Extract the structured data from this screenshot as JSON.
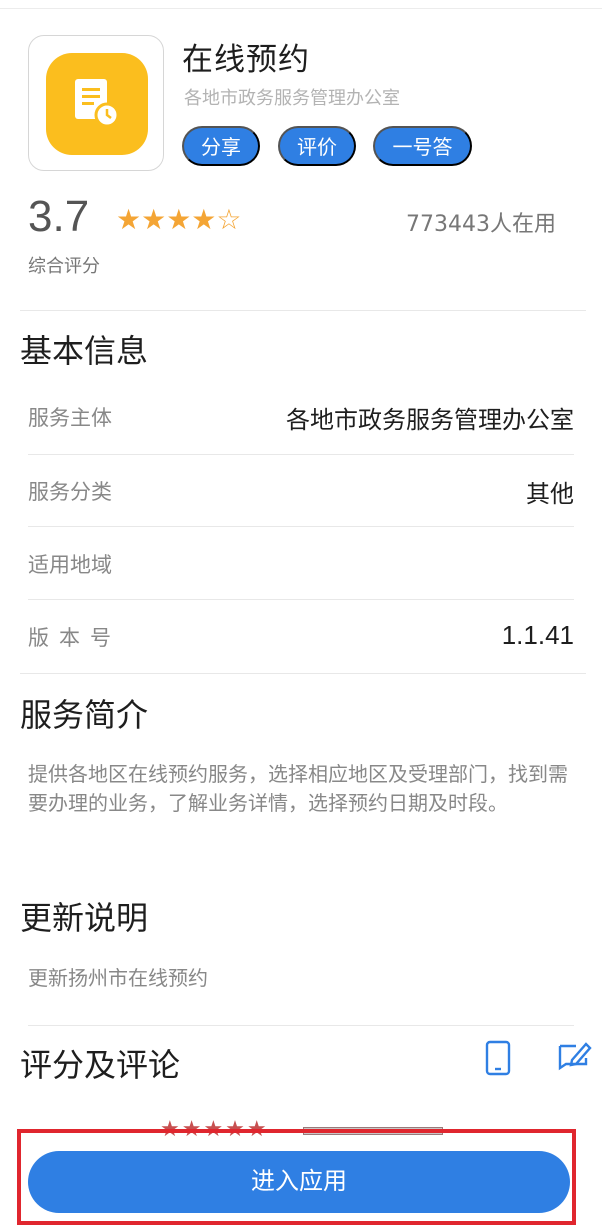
{
  "app": {
    "title": "在线预约",
    "publisher": "各地市政务服务管理办公室",
    "icon": "document-clock-icon"
  },
  "actions": {
    "share": "分享",
    "rate": "评价",
    "ask": "一号答"
  },
  "rating": {
    "score": "3.7",
    "stars": "★★★★☆",
    "users": "773443人在用",
    "label": "综合评分",
    "accent": "#f4a535"
  },
  "basic_info": {
    "title": "基本信息",
    "rows": [
      {
        "label": "服务主体",
        "value": "各地市政务服务管理办公室"
      },
      {
        "label": "服务分类",
        "value": "其他"
      },
      {
        "label": "适用地域",
        "value": ""
      },
      {
        "label": "版本号",
        "value": "1.1.41"
      }
    ]
  },
  "intro": {
    "title": "服务简介",
    "text": "提供各地区在线预约服务，选择相应地区及受理部门，找到需要办理的业务，了解业务详情，选择预约日期及时段。"
  },
  "update": {
    "title": "更新说明",
    "text": "更新扬州市在线预约"
  },
  "reviews": {
    "title": "评分及评论",
    "icons": [
      "phone-icon",
      "edit-review-icon"
    ],
    "mini_stars": "★★★★★"
  },
  "enter_button": "进入应用",
  "colors": {
    "primary": "#2f7fe3",
    "highlight_frame": "#e0262e",
    "icon_bg": "#fbbe1e"
  }
}
